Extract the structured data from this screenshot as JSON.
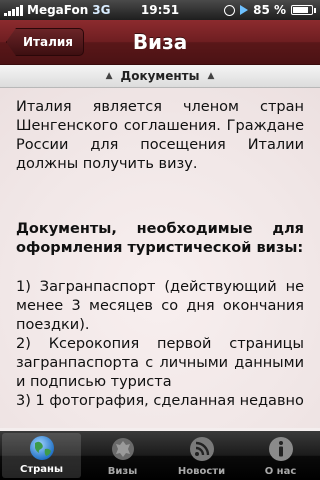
{
  "status_bar": {
    "carrier": "MegaFon",
    "network": "3G",
    "time": "19:51",
    "battery": "85 %",
    "battery_level": 0.85
  },
  "nav": {
    "back_label": "Италия",
    "title": "Виза"
  },
  "section": {
    "label": "Документы"
  },
  "content": {
    "intro": "Италия является членом стран Шенгенского соглашения. Граждане России для посещения Италии должны получить визу.",
    "heading": "Документы, необходимые для оформления туристической визы:",
    "items": [
      "1) Загранпаспорт (действующий не менее 3 месяцев со дня окончания поездки).",
      "2) Ксерокопия первой страницы загранпаспорта с личными данными и подписью туриста",
      "3) 1 фотография, сделанная недавно"
    ]
  },
  "tabs": [
    {
      "label": "Страны",
      "icon": "globe-icon",
      "active": true
    },
    {
      "label": "Визы",
      "icon": "emblem-icon",
      "active": false
    },
    {
      "label": "Новости",
      "icon": "rss-icon",
      "active": false
    },
    {
      "label": "О нас",
      "icon": "info-icon",
      "active": false
    }
  ],
  "colors": {
    "nav_bar": "#6e1e21",
    "background": "#f4eeee",
    "tab_bar": "#1b1b1b"
  }
}
